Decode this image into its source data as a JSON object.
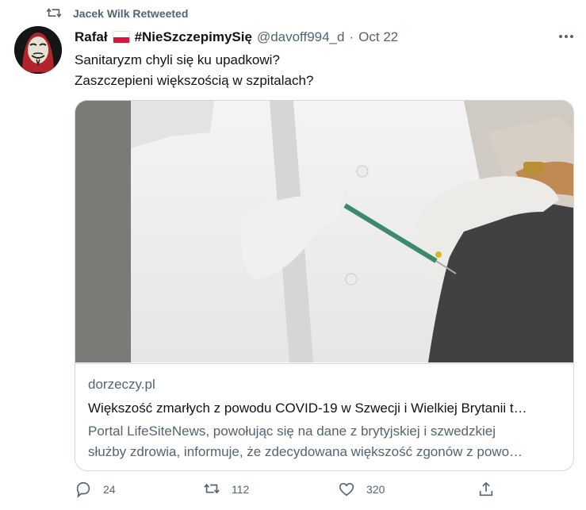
{
  "retweet": {
    "label": "Jacek Wilk Retweeted",
    "icon": "retweet-icon"
  },
  "author": {
    "name": "Rafał",
    "hashtag_name": "#NieSzczepimySię",
    "handle": "@davoff994_d",
    "separator": "·",
    "date": "Oct 22"
  },
  "tweet": {
    "lines": [
      "Sanitaryzm chyli się ku upadkowi?",
      "Zaszczepieni większością w szpitalach?"
    ]
  },
  "card": {
    "domain": "dorzeczy.pl",
    "title": "Większość zmarłych z powodu COVID-19 w Szwecji i Wielkiej Brytanii t…",
    "description_lines": [
      "Portal LifeSiteNews, powołując się na dane z brytyjskiej i szwedzkiej",
      "służby zdrowia, informuje, że zdecydowana większość zgonów z powo…"
    ]
  },
  "actions": {
    "reply_count": "24",
    "retweet_count": "112",
    "like_count": "320"
  },
  "colors": {
    "text": "#0f1419",
    "secondary": "#536471",
    "border": "#cfd9de",
    "flag_red": "#dc143c"
  }
}
